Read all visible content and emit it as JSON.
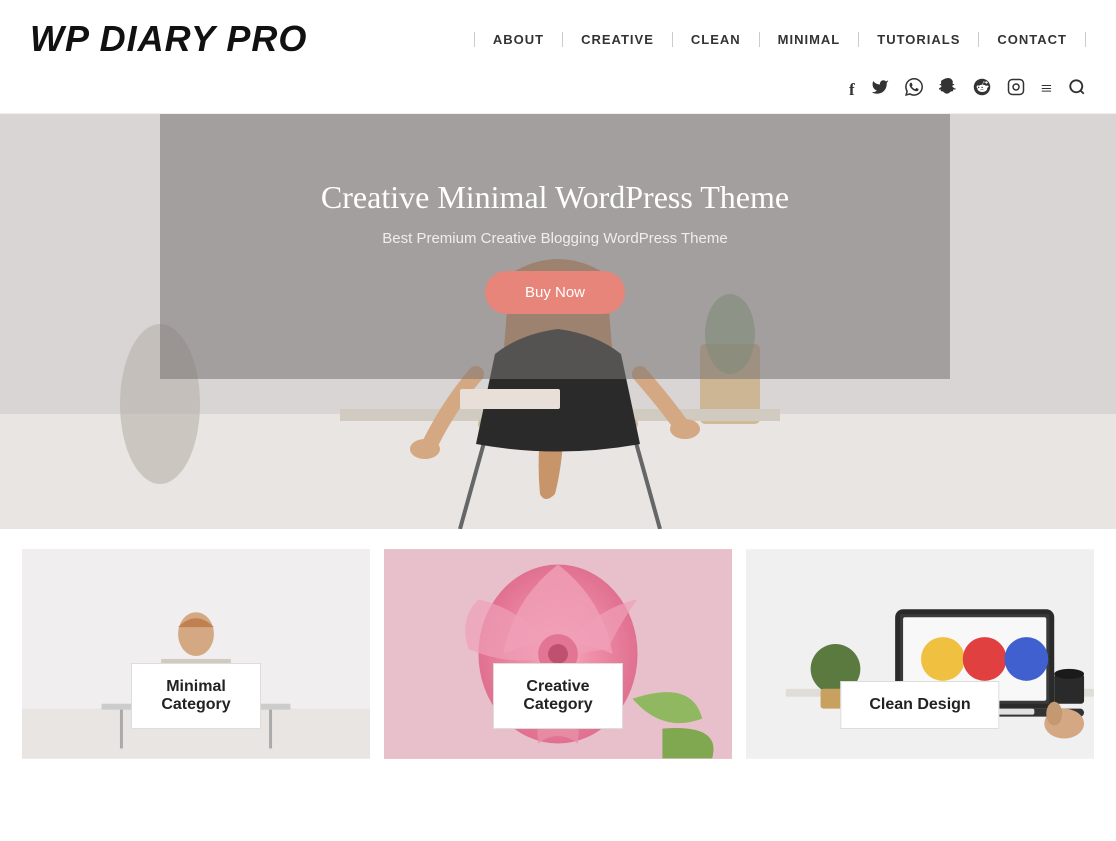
{
  "site": {
    "title": "WP DIARY PRO"
  },
  "nav": {
    "items": [
      {
        "label": "ABOUT",
        "id": "about"
      },
      {
        "label": "CREATIVE",
        "id": "creative"
      },
      {
        "label": "CLEAN",
        "id": "clean"
      },
      {
        "label": "MINIMAL",
        "id": "minimal"
      },
      {
        "label": "TUTORIALS",
        "id": "tutorials"
      },
      {
        "label": "CONTACT",
        "id": "contact"
      }
    ]
  },
  "social": {
    "icons": [
      {
        "name": "facebook",
        "symbol": "f"
      },
      {
        "name": "twitter",
        "symbol": "t"
      },
      {
        "name": "whatsapp",
        "symbol": "w"
      },
      {
        "name": "snapchat",
        "symbol": "s"
      },
      {
        "name": "reddit",
        "symbol": "r"
      },
      {
        "name": "instagram",
        "symbol": "i"
      },
      {
        "name": "menu",
        "symbol": "≡"
      },
      {
        "name": "search",
        "symbol": "🔍"
      }
    ]
  },
  "hero": {
    "title": "Creative Minimal WordPress Theme",
    "subtitle": "Best Premium Creative Blogging WordPress Theme",
    "button_label": "Buy Now"
  },
  "cards": [
    {
      "id": "minimal",
      "label_line1": "Minimal",
      "label_line2": "Category",
      "bg": "#f0eeee"
    },
    {
      "id": "creative",
      "label_line1": "Creative",
      "label_line2": "Category",
      "bg": "#f0c8ce"
    },
    {
      "id": "clean",
      "label_line1": "Clean Design",
      "label_line2": "",
      "bg": "#f5f5f5"
    }
  ]
}
